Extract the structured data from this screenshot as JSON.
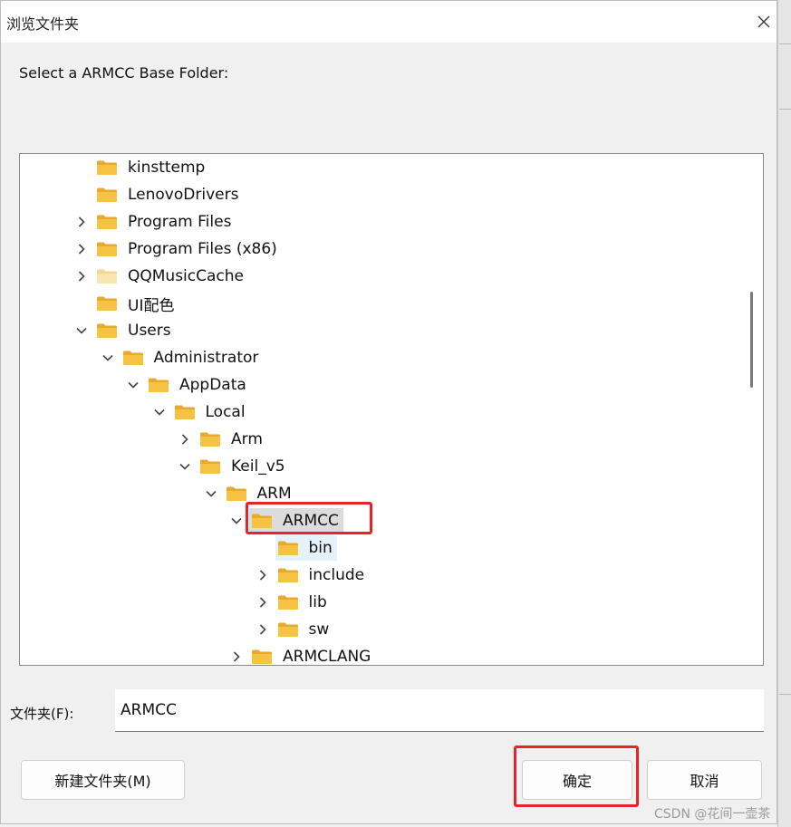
{
  "dialog": {
    "title": "浏览文件夹",
    "prompt": "Select a ARMCC Base Folder:",
    "folder_label": "文件夹(F):",
    "folder_value": "ARMCC",
    "buttons": {
      "new_folder": "新建文件夹(M)",
      "ok": "确定",
      "cancel": "取消"
    }
  },
  "tree": {
    "items": [
      {
        "label": "kinsttemp",
        "depth": 0,
        "expander": "none"
      },
      {
        "label": "LenovoDrivers",
        "depth": 0,
        "expander": "none"
      },
      {
        "label": "Program Files",
        "depth": 0,
        "expander": "collapsed"
      },
      {
        "label": "Program Files (x86)",
        "depth": 0,
        "expander": "collapsed"
      },
      {
        "label": "QQMusicCache",
        "depth": 0,
        "expander": "collapsed",
        "hidden_folder": true
      },
      {
        "label": "UI配色",
        "depth": 0,
        "expander": "none"
      },
      {
        "label": "Users",
        "depth": 0,
        "expander": "expanded"
      },
      {
        "label": "Administrator",
        "depth": 1,
        "expander": "expanded"
      },
      {
        "label": "AppData",
        "depth": 2,
        "expander": "expanded"
      },
      {
        "label": "Local",
        "depth": 3,
        "expander": "expanded"
      },
      {
        "label": "Arm",
        "depth": 4,
        "expander": "collapsed"
      },
      {
        "label": "Keil_v5",
        "depth": 4,
        "expander": "expanded"
      },
      {
        "label": "ARM",
        "depth": 5,
        "expander": "expanded"
      },
      {
        "label": "ARMCC",
        "depth": 6,
        "expander": "expanded",
        "selected": true
      },
      {
        "label": "bin",
        "depth": 7,
        "expander": "none",
        "hover": true
      },
      {
        "label": "include",
        "depth": 7,
        "expander": "collapsed"
      },
      {
        "label": "lib",
        "depth": 7,
        "expander": "collapsed"
      },
      {
        "label": "sw",
        "depth": 7,
        "expander": "collapsed"
      },
      {
        "label": "ARMCLANG",
        "depth": 6,
        "expander": "collapsed"
      }
    ]
  },
  "watermark": "CSDN @花间一壶茶",
  "colors": {
    "folder": "#f5c242",
    "folder_hidden": "#f8e6b0",
    "highlight": "#e8232a"
  },
  "icons": {
    "close": "close-icon",
    "folder": "folder-icon",
    "expander_collapsed": "chevron-right-icon",
    "expander_expanded": "chevron-down-icon"
  }
}
